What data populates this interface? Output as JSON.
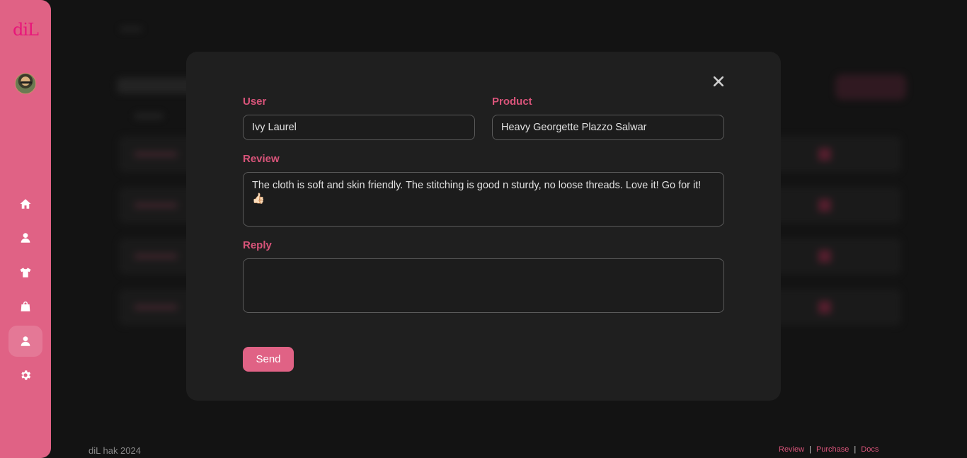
{
  "sidebar": {
    "logo": "diL",
    "nav": [
      {
        "name": "home",
        "icon": "home-icon"
      },
      {
        "name": "users",
        "icon": "user-icon"
      },
      {
        "name": "products",
        "icon": "tshirt-icon"
      },
      {
        "name": "orders",
        "icon": "shopping-bag-icon"
      },
      {
        "name": "reviews",
        "icon": "user-icon",
        "active": true
      },
      {
        "name": "settings",
        "icon": "gear-icon"
      }
    ]
  },
  "modal": {
    "user": {
      "label": "User",
      "value": "Ivy Laurel"
    },
    "product": {
      "label": "Product",
      "value": "Heavy Georgette Plazzo Salwar"
    },
    "review": {
      "label": "Review",
      "value": "The cloth is soft and skin friendly. The stitching is good n sturdy, no loose threads. Love it! Go for it! 👍🏻"
    },
    "reply": {
      "label": "Reply",
      "value": ""
    },
    "send_label": "Send",
    "close_icon": "close-icon"
  },
  "footer": {
    "copyright": "diL hak 2024",
    "links": [
      "Review",
      "Purchase",
      "Docs"
    ]
  },
  "colors": {
    "accent": "#e06285",
    "label": "#d9547a",
    "background": "#131313",
    "modal": "#1f1f1f"
  }
}
